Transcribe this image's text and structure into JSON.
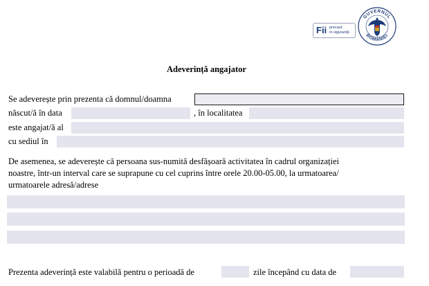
{
  "header": {
    "badge_big": "Fii",
    "badge_small_1": "precaut",
    "badge_small_2": "în siguranță",
    "seal_top": "GUVERNUL",
    "seal_bottom": "ROMÂNIEI"
  },
  "title": "Adeverință angajator",
  "form": {
    "line1_label": "Se adeverește prin prezenta că domnul/doamna",
    "line2_label_a": "născut/ă în data",
    "line2_label_b": ", în localitatea",
    "line3_label": "este angajat/ă al",
    "line4_label": "cu sediul în",
    "fields": {
      "name": "",
      "birth_date": "",
      "birth_place": "",
      "employer": "",
      "headquarters": "",
      "address_1": "",
      "address_2": "",
      "address_3": "",
      "period_days": "",
      "start_date": ""
    }
  },
  "paragraph": {
    "line1": "De asemenea, se adeverește că persoana sus-numită desfășoară activitatea în cadrul organizației",
    "line2": "noastre, într-un interval care se suprapune cu cel cuprins între orele 20.00-05.00, la urmatoarea/",
    "line3": "urmatoarele adresă/adrese"
  },
  "validity": {
    "label_a": "Prezenta adeverință este valabilă pentru o perioadă de",
    "label_b": "zile începând cu data de"
  },
  "colors": {
    "field_bg": "#e4e4ee",
    "brand_blue": "#1d3b7a"
  }
}
